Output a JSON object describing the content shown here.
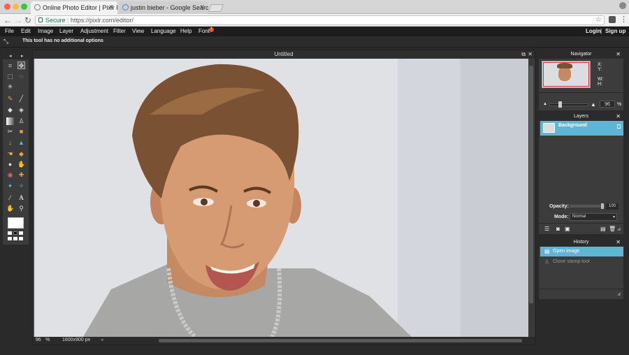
{
  "browser": {
    "tabs": [
      {
        "title": "Online Photo Editor | Pixlr Edit"
      },
      {
        "title": "justin bieber - Google Search"
      }
    ],
    "secure_label": "Secure",
    "url": "https://pixlr.com/editor/"
  },
  "app": {
    "menus": [
      "File",
      "Edit",
      "Image",
      "Layer",
      "Adjustment",
      "Filter",
      "View",
      "Language",
      "Help",
      "Font"
    ],
    "font_badge": "!",
    "login": "Login",
    "separator": "|",
    "signup": "Sign up",
    "tool_hint": "This tool has no additional options"
  },
  "canvas": {
    "title": "Untitled",
    "zoom": "96",
    "zoom_unit": "%",
    "dimensions": "1600x900 px"
  },
  "navigator": {
    "title": "Navigator",
    "x_label": "X:",
    "y_label": "Y:",
    "w_label": "W:",
    "h_label": "H:",
    "zoom": "96",
    "zoom_unit": "%"
  },
  "layers": {
    "title": "Layers",
    "items": [
      {
        "name": "Background",
        "selected": true
      }
    ],
    "opacity_label": "Opacity:",
    "opacity_value": "100",
    "mode_label": "Mode:",
    "mode_value": "Normal"
  },
  "history": {
    "title": "History",
    "items": [
      {
        "name": "Open image",
        "selected": true
      },
      {
        "name": "Clone stamp tool",
        "selected": false
      }
    ]
  },
  "colors": {
    "accent": "#5db6d6",
    "menubar": "#1d1d1d",
    "panel": "#3c3c3c"
  }
}
